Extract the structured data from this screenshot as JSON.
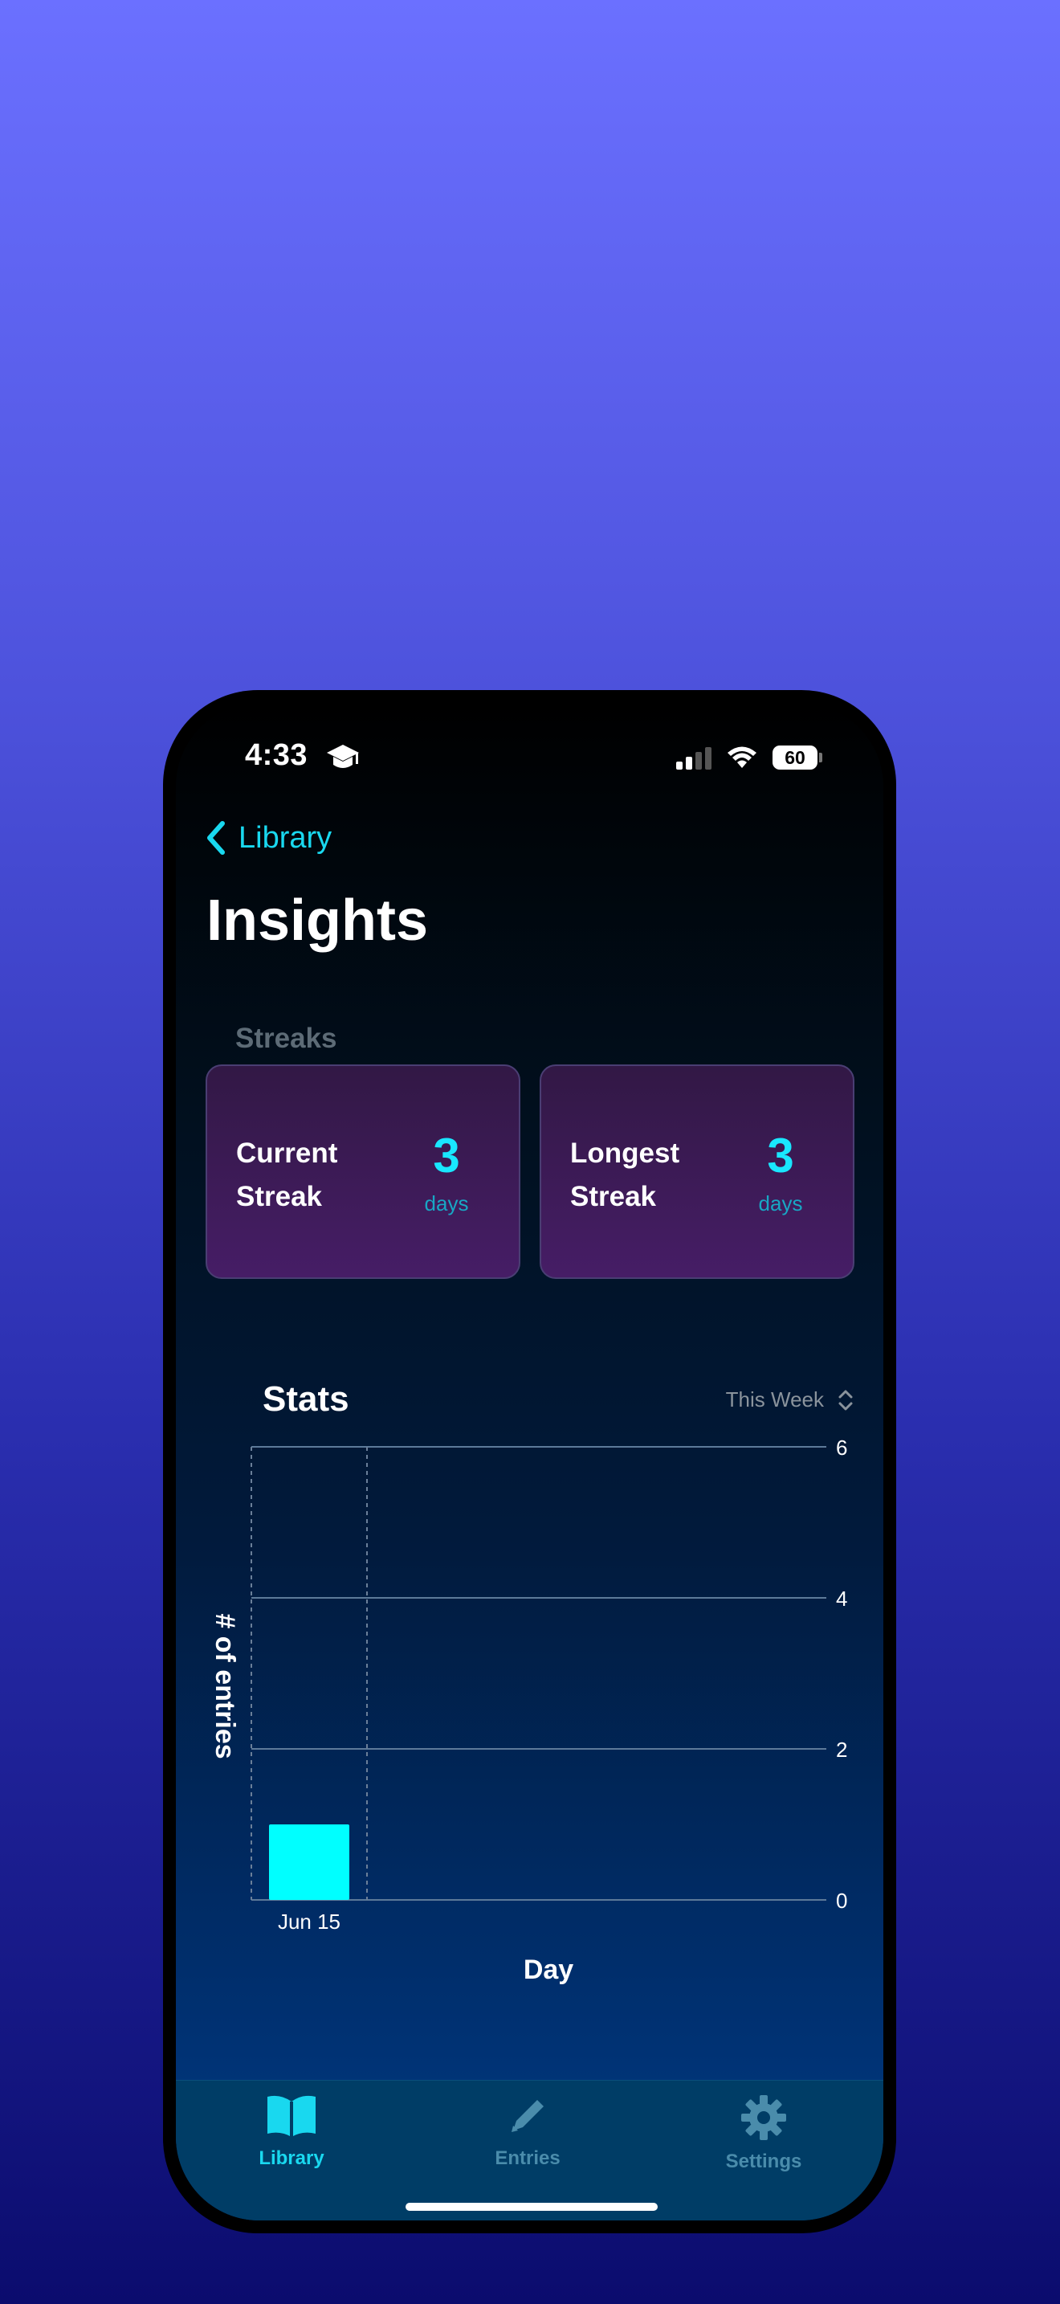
{
  "status_bar": {
    "time": "4:33",
    "battery": "60"
  },
  "nav": {
    "back_label": "Library",
    "title": "Insights"
  },
  "streaks": {
    "section_label": "Streaks",
    "cards": [
      {
        "label": "Current Streak",
        "value": "3",
        "unit": "days"
      },
      {
        "label": "Longest Streak",
        "value": "3",
        "unit": "days"
      }
    ]
  },
  "stats": {
    "title": "Stats",
    "range_selected": "This Week"
  },
  "chart_data": {
    "type": "bar",
    "categories": [
      "Jun 15"
    ],
    "values": [
      1
    ],
    "xlabel": "Day",
    "ylabel": "# of entries",
    "ylim": [
      0,
      6
    ],
    "yticks": [
      "0",
      "2",
      "4",
      "6"
    ],
    "grid": true,
    "color": "#00ffff"
  },
  "tabbar": {
    "items": [
      {
        "label": "Library",
        "active": true
      },
      {
        "label": "Entries",
        "active": false
      },
      {
        "label": "Settings",
        "active": false
      }
    ],
    "active_color": "#19d8ef",
    "inactive_color": "#4a8cab"
  }
}
